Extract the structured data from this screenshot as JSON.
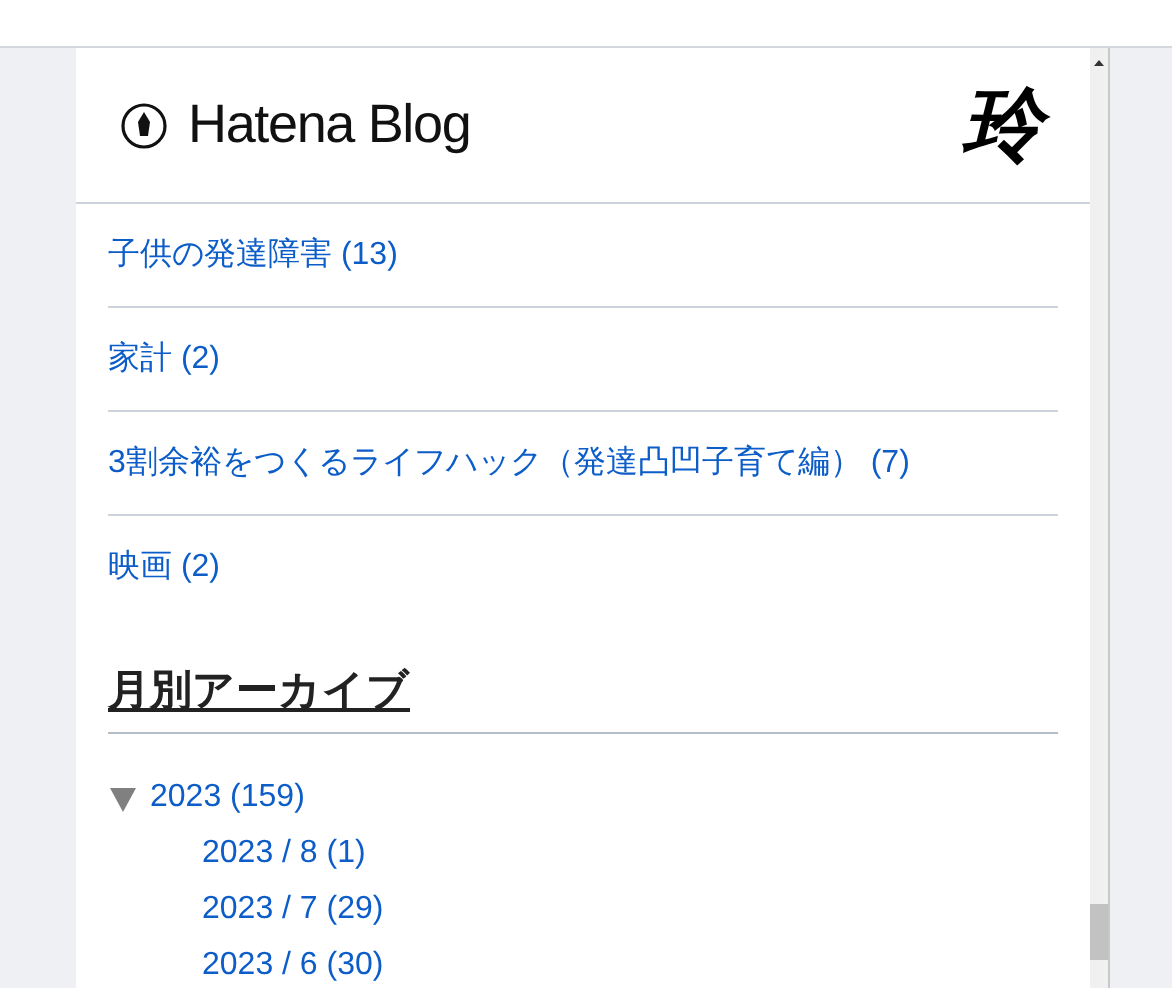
{
  "header": {
    "logo_text": "Hatena Blog",
    "site_mark": "玲"
  },
  "categories": [
    {
      "label": "子供の発達障害 (13)"
    },
    {
      "label": "家計 (2)"
    },
    {
      "label": "3割余裕をつくるライフハック（発達凸凹子育て編） (7)"
    },
    {
      "label": "映画 (2)"
    }
  ],
  "archive": {
    "heading": "月別アーカイブ",
    "years": [
      {
        "label": "2023 (159)",
        "expanded": true,
        "children": [
          {
            "label": "2023 / 8 (1)"
          },
          {
            "label": "2023 / 7 (29)"
          },
          {
            "label": "2023 / 6 (30)"
          }
        ]
      }
    ]
  }
}
